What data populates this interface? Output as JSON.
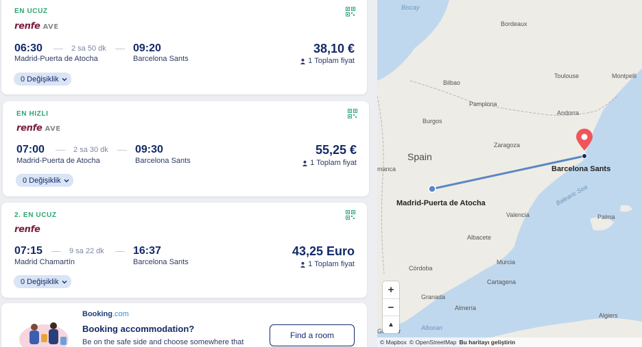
{
  "results": [
    {
      "tag": "EN UCUZ",
      "operator": "renfe",
      "service": "AVE",
      "depart_time": "06:30",
      "duration": "2 sa 50 dk",
      "arrive_time": "09:20",
      "origin": "Madrid-Puerta de Atocha",
      "destination": "Barcelona Sants",
      "price": "38,10 €",
      "passengers": "1",
      "price_note": "Toplam fiyat",
      "changes": "0 Değişiklik"
    },
    {
      "tag": "EN HIZLI",
      "operator": "renfe",
      "service": "AVE",
      "depart_time": "07:00",
      "duration": "2 sa 30 dk",
      "arrive_time": "09:30",
      "origin": "Madrid-Puerta de Atocha",
      "destination": "Barcelona Sants",
      "price": "55,25 €",
      "passengers": "1",
      "price_note": "Toplam fiyat",
      "changes": "0 Değişiklik"
    },
    {
      "tag": "2. EN UCUZ",
      "operator": "renfe",
      "service": "",
      "depart_time": "07:15",
      "duration": "9 sa 22 dk",
      "arrive_time": "16:37",
      "origin": "Madrid Chamartín",
      "destination": "Barcelona Sants",
      "price": "43,25 Euro",
      "passengers": "1",
      "price_note": "Toplam fiyat",
      "changes": "0 Değişiklik"
    }
  ],
  "promo": {
    "brand_name": "Booking",
    "brand_suffix": ".com",
    "title": "Booking accommodation?",
    "text": "Be on the safe side and choose somewhere that",
    "button": "Find a room"
  },
  "map": {
    "labels": {
      "biscay": "Biscay",
      "bordeaux": "Bordeaux",
      "toulouse": "Toulouse",
      "montpellier": "Montpelli",
      "bilbao": "Bilbao",
      "pamplona": "Pamplona",
      "andorra": "Andorra",
      "burgos": "Burgos",
      "zaragoza": "Zaragoza",
      "spain": "Spain",
      "salamanca": "manca",
      "valencia": "Valencia",
      "albacete": "Albacete",
      "murcia": "Murcia",
      "cordoba": "Córdoba",
      "cartagena": "Cartagena",
      "granada": "Granada",
      "almeria": "Almería",
      "algiers": "Algiers",
      "balearic": "Balearic Sea",
      "palma": "Palma",
      "alboran": "Alboran",
      "gibraltar": "Gibraltar"
    },
    "origin_label": "Madrid-Puerta de Atocha",
    "destination_label": "Barcelona Sants",
    "zoom_in": "+",
    "zoom_out": "−",
    "compass": "▲",
    "attribution_mapbox": "© Mapbox",
    "attribution_osm": "© OpenStreetMap",
    "improve": "Bu haritayı geliştirin"
  },
  "colors": {
    "accent_green": "#2aa672",
    "navy": "#132968",
    "route": "#5b87c4",
    "pin": "#f0555a"
  }
}
